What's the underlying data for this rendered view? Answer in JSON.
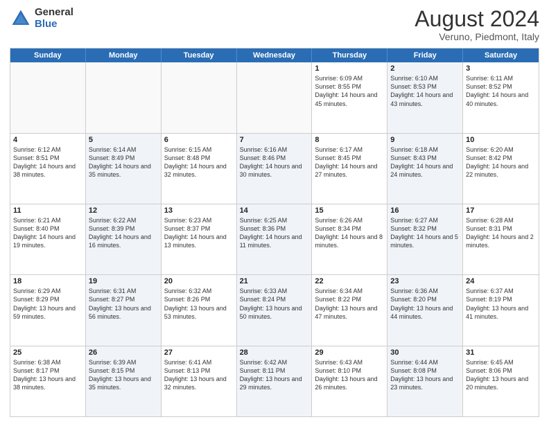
{
  "header": {
    "logo_general": "General",
    "logo_blue": "Blue",
    "month_title": "August 2024",
    "location": "Veruno, Piedmont, Italy"
  },
  "days_of_week": [
    "Sunday",
    "Monday",
    "Tuesday",
    "Wednesday",
    "Thursday",
    "Friday",
    "Saturday"
  ],
  "weeks": [
    [
      {
        "day": "",
        "text": "",
        "shaded": false,
        "empty": true
      },
      {
        "day": "",
        "text": "",
        "shaded": false,
        "empty": true
      },
      {
        "day": "",
        "text": "",
        "shaded": false,
        "empty": true
      },
      {
        "day": "",
        "text": "",
        "shaded": false,
        "empty": true
      },
      {
        "day": "1",
        "text": "Sunrise: 6:09 AM\nSunset: 8:55 PM\nDaylight: 14 hours and 45 minutes.",
        "shaded": false,
        "empty": false
      },
      {
        "day": "2",
        "text": "Sunrise: 6:10 AM\nSunset: 8:53 PM\nDaylight: 14 hours and 43 minutes.",
        "shaded": true,
        "empty": false
      },
      {
        "day": "3",
        "text": "Sunrise: 6:11 AM\nSunset: 8:52 PM\nDaylight: 14 hours and 40 minutes.",
        "shaded": false,
        "empty": false
      }
    ],
    [
      {
        "day": "4",
        "text": "Sunrise: 6:12 AM\nSunset: 8:51 PM\nDaylight: 14 hours and 38 minutes.",
        "shaded": false,
        "empty": false
      },
      {
        "day": "5",
        "text": "Sunrise: 6:14 AM\nSunset: 8:49 PM\nDaylight: 14 hours and 35 minutes.",
        "shaded": true,
        "empty": false
      },
      {
        "day": "6",
        "text": "Sunrise: 6:15 AM\nSunset: 8:48 PM\nDaylight: 14 hours and 32 minutes.",
        "shaded": false,
        "empty": false
      },
      {
        "day": "7",
        "text": "Sunrise: 6:16 AM\nSunset: 8:46 PM\nDaylight: 14 hours and 30 minutes.",
        "shaded": true,
        "empty": false
      },
      {
        "day": "8",
        "text": "Sunrise: 6:17 AM\nSunset: 8:45 PM\nDaylight: 14 hours and 27 minutes.",
        "shaded": false,
        "empty": false
      },
      {
        "day": "9",
        "text": "Sunrise: 6:18 AM\nSunset: 8:43 PM\nDaylight: 14 hours and 24 minutes.",
        "shaded": true,
        "empty": false
      },
      {
        "day": "10",
        "text": "Sunrise: 6:20 AM\nSunset: 8:42 PM\nDaylight: 14 hours and 22 minutes.",
        "shaded": false,
        "empty": false
      }
    ],
    [
      {
        "day": "11",
        "text": "Sunrise: 6:21 AM\nSunset: 8:40 PM\nDaylight: 14 hours and 19 minutes.",
        "shaded": false,
        "empty": false
      },
      {
        "day": "12",
        "text": "Sunrise: 6:22 AM\nSunset: 8:39 PM\nDaylight: 14 hours and 16 minutes.",
        "shaded": true,
        "empty": false
      },
      {
        "day": "13",
        "text": "Sunrise: 6:23 AM\nSunset: 8:37 PM\nDaylight: 14 hours and 13 minutes.",
        "shaded": false,
        "empty": false
      },
      {
        "day": "14",
        "text": "Sunrise: 6:25 AM\nSunset: 8:36 PM\nDaylight: 14 hours and 11 minutes.",
        "shaded": true,
        "empty": false
      },
      {
        "day": "15",
        "text": "Sunrise: 6:26 AM\nSunset: 8:34 PM\nDaylight: 14 hours and 8 minutes.",
        "shaded": false,
        "empty": false
      },
      {
        "day": "16",
        "text": "Sunrise: 6:27 AM\nSunset: 8:32 PM\nDaylight: 14 hours and 5 minutes.",
        "shaded": true,
        "empty": false
      },
      {
        "day": "17",
        "text": "Sunrise: 6:28 AM\nSunset: 8:31 PM\nDaylight: 14 hours and 2 minutes.",
        "shaded": false,
        "empty": false
      }
    ],
    [
      {
        "day": "18",
        "text": "Sunrise: 6:29 AM\nSunset: 8:29 PM\nDaylight: 13 hours and 59 minutes.",
        "shaded": false,
        "empty": false
      },
      {
        "day": "19",
        "text": "Sunrise: 6:31 AM\nSunset: 8:27 PM\nDaylight: 13 hours and 56 minutes.",
        "shaded": true,
        "empty": false
      },
      {
        "day": "20",
        "text": "Sunrise: 6:32 AM\nSunset: 8:26 PM\nDaylight: 13 hours and 53 minutes.",
        "shaded": false,
        "empty": false
      },
      {
        "day": "21",
        "text": "Sunrise: 6:33 AM\nSunset: 8:24 PM\nDaylight: 13 hours and 50 minutes.",
        "shaded": true,
        "empty": false
      },
      {
        "day": "22",
        "text": "Sunrise: 6:34 AM\nSunset: 8:22 PM\nDaylight: 13 hours and 47 minutes.",
        "shaded": false,
        "empty": false
      },
      {
        "day": "23",
        "text": "Sunrise: 6:36 AM\nSunset: 8:20 PM\nDaylight: 13 hours and 44 minutes.",
        "shaded": true,
        "empty": false
      },
      {
        "day": "24",
        "text": "Sunrise: 6:37 AM\nSunset: 8:19 PM\nDaylight: 13 hours and 41 minutes.",
        "shaded": false,
        "empty": false
      }
    ],
    [
      {
        "day": "25",
        "text": "Sunrise: 6:38 AM\nSunset: 8:17 PM\nDaylight: 13 hours and 38 minutes.",
        "shaded": false,
        "empty": false
      },
      {
        "day": "26",
        "text": "Sunrise: 6:39 AM\nSunset: 8:15 PM\nDaylight: 13 hours and 35 minutes.",
        "shaded": true,
        "empty": false
      },
      {
        "day": "27",
        "text": "Sunrise: 6:41 AM\nSunset: 8:13 PM\nDaylight: 13 hours and 32 minutes.",
        "shaded": false,
        "empty": false
      },
      {
        "day": "28",
        "text": "Sunrise: 6:42 AM\nSunset: 8:11 PM\nDaylight: 13 hours and 29 minutes.",
        "shaded": true,
        "empty": false
      },
      {
        "day": "29",
        "text": "Sunrise: 6:43 AM\nSunset: 8:10 PM\nDaylight: 13 hours and 26 minutes.",
        "shaded": false,
        "empty": false
      },
      {
        "day": "30",
        "text": "Sunrise: 6:44 AM\nSunset: 8:08 PM\nDaylight: 13 hours and 23 minutes.",
        "shaded": true,
        "empty": false
      },
      {
        "day": "31",
        "text": "Sunrise: 6:45 AM\nSunset: 8:06 PM\nDaylight: 13 hours and 20 minutes.",
        "shaded": false,
        "empty": false
      }
    ]
  ]
}
